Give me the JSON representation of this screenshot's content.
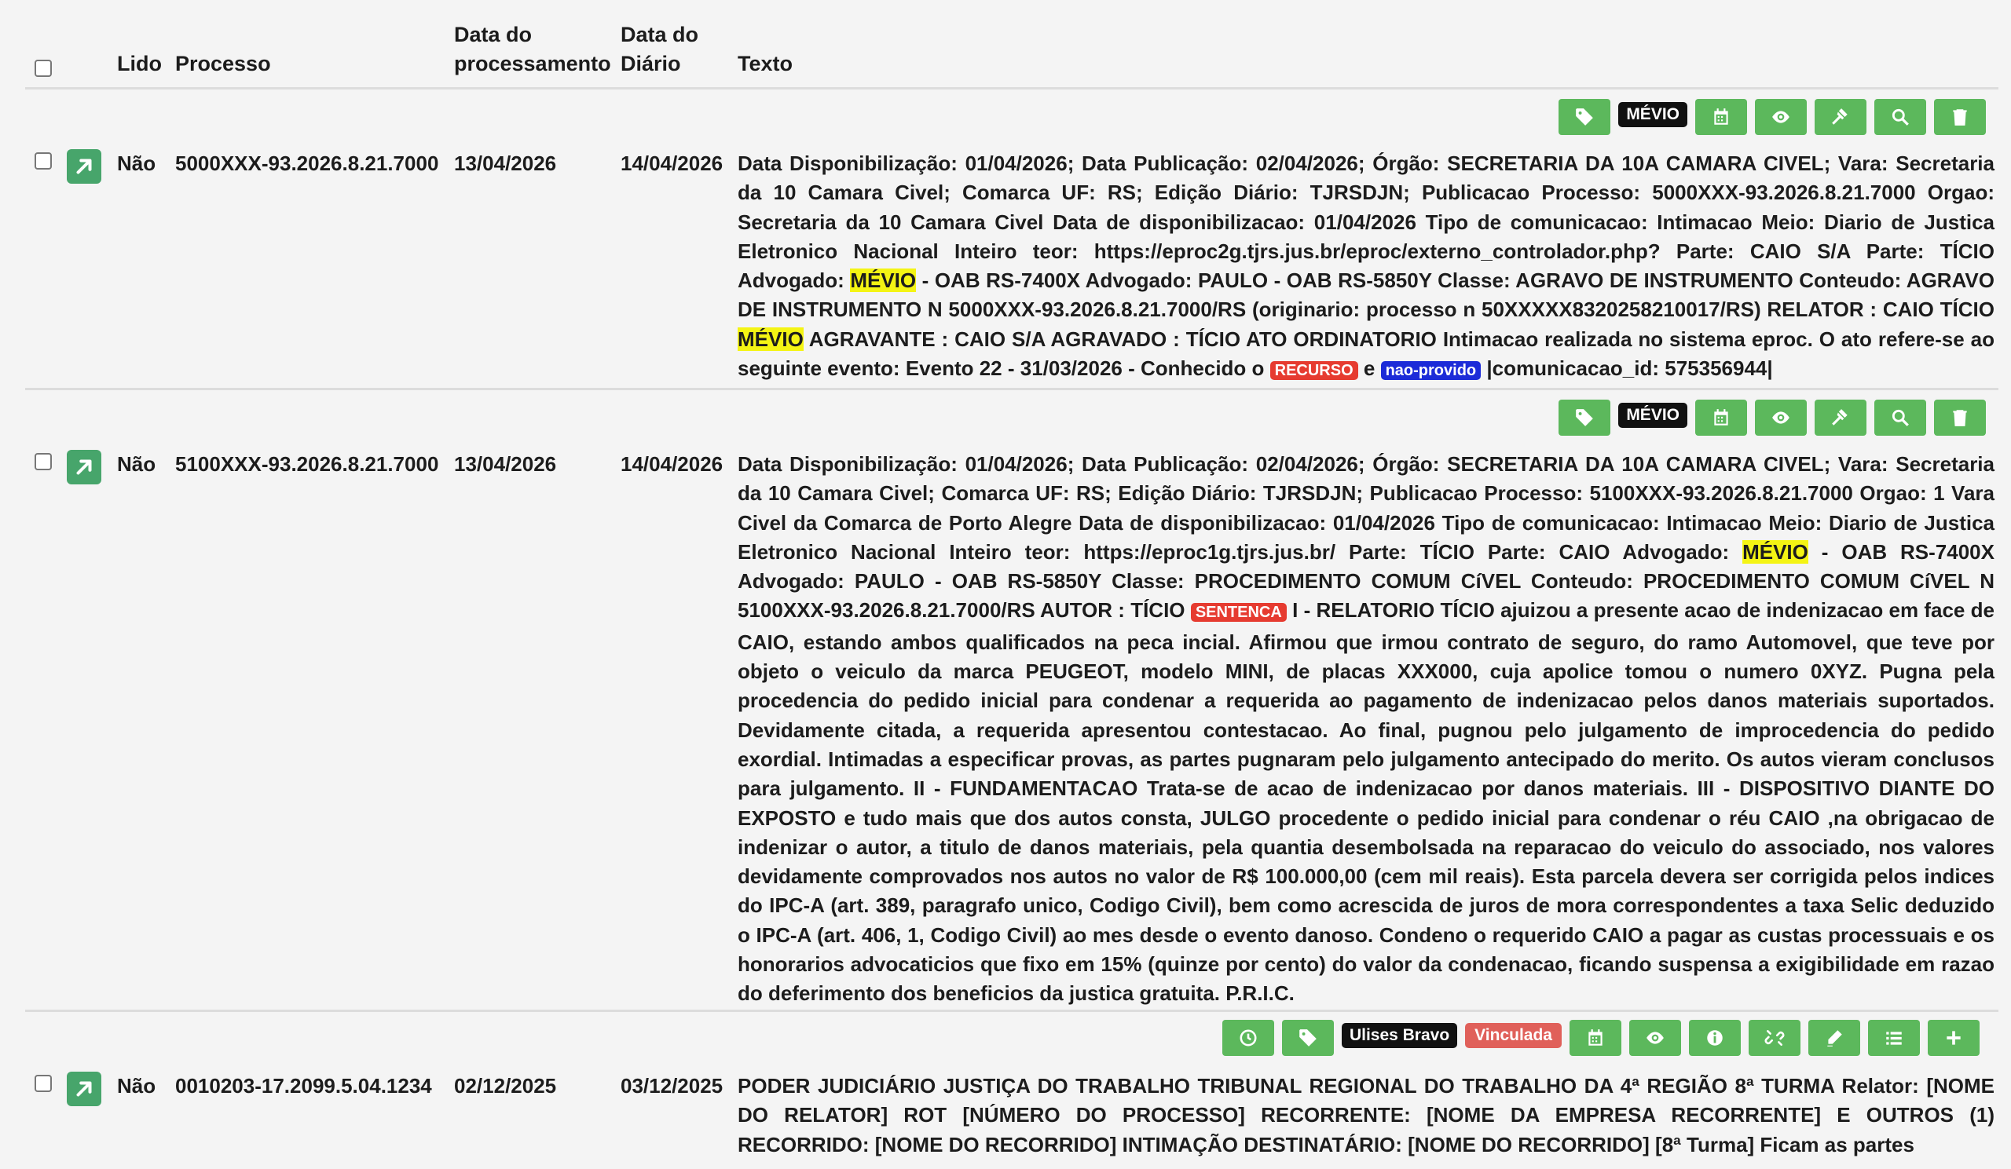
{
  "header": {
    "lido": "Lido",
    "processo": "Processo",
    "data_processamento_l1": "Data do",
    "data_processamento_l2": "processamento",
    "data_diario_l1": "Data do",
    "data_diario_l2": "Diário",
    "texto": "Texto"
  },
  "rows": [
    {
      "lido": "Não",
      "processo": "5000XXX-93.2026.8.21.7000",
      "data_processamento": "13/04/2026",
      "data_diario": "14/04/2026",
      "user_tag": "MÉVIO",
      "texto": {
        "p1": "Data Disponibilização: 01/04/2026; Data Publicação: 02/04/2026; Órgão: SECRETARIA DA 10A CAMARA CIVEL; Vara: Secretaria da 10 Camara Civel; Comarca UF: RS; Edição Diário: TJRSDJN; Publicacao Processo: 5000XXX-93.2026.8.21.7000 Orgao: Secretaria da 10 Camara Civel Data de disponibilizacao: 01/04/2026 Tipo de comunicacao: Intimacao Meio: Diario de Justica Eletronico Nacional Inteiro teor: https://eproc2g.tjrs.jus.br/eproc/externo_controlador.php? Parte: CAIO S/A Parte: TÍCIO Advogado: ",
        "hl1": "MÉVIO",
        "p2": " - OAB RS-7400X Advogado: PAULO - OAB RS-5850Y Classe: AGRAVO DE INSTRUMENTO Conteudo: AGRAVO DE INSTRUMENTO N 5000XXX-93.2026.8.21.7000/RS (originario: processo n 50XXXXX8320258210017/RS) RELATOR : CAIO TÍCIO ",
        "hl2": "MÉVIO",
        "p3": " AGRAVANTE : CAIO S/A AGRAVADO : TÍCIO ATO ORDINATORIO Intimacao realizada no sistema eproc. O ato refere-se ao seguinte evento: Evento 22 - 31/03/2026 - Conhecido o ",
        "badge1": "RECURSO",
        "p4": " e ",
        "badge2": "nao-provido",
        "p5": " |comunicacao_id: 575356944|"
      }
    },
    {
      "lido": "Não",
      "processo": "5100XXX-93.2026.8.21.7000",
      "data_processamento": "13/04/2026",
      "data_diario": "14/04/2026",
      "user_tag": "MÉVIO",
      "texto": {
        "p1": "Data Disponibilização: 01/04/2026; Data Publicação: 02/04/2026; Órgão: SECRETARIA DA 10A CAMARA CIVEL; Vara: Secretaria da 10 Camara Civel; Comarca UF: RS; Edição Diário: TJRSDJN; Publicacao Processo: 5100XXX-93.2026.8.21.7000 Orgao: 1 Vara Civel da Comarca de Porto Alegre Data de disponibilizacao: 01/04/2026 Tipo de comunicacao: Intimacao Meio: Diario de Justica Eletronico Nacional Inteiro teor: https://eproc1g.tjrs.jus.br/ Parte: TÍCIO Parte: CAIO Advogado: ",
        "hl1": "MÉVIO",
        "p2": " - OAB RS-7400X Advogado: PAULO - OAB RS-5850Y Classe: PROCEDIMENTO COMUM CíVEL Conteudo: PROCEDIMENTO COMUM CíVEL N 5100XXX-93.2026.8.21.7000/RS AUTOR : TÍCIO ",
        "badge1": "SENTENCA",
        "p3": " I - RELATORIO TÍCIO ajuizou a presente acao de indenizacao em face de CAIO, estando ambos qualificados na peca incial. Afirmou que irmou contrato de seguro, do ramo Automovel, que teve por objeto o veiculo da marca PEUGEOT, modelo MINI, de placas XXX000, cuja apolice tomou o numero 0XYZ. Pugna pela procedencia do pedido inicial para condenar a requerida ao pagamento de indenizacao pelos danos materiais suportados. Devidamente citada, a requerida apresentou contestacao. Ao final, pugnou pelo julgamento de improcedencia do pedido exordial. Intimadas a especificar provas, as partes pugnaram pelo julgamento antecipado do merito. Os autos vieram conclusos para julgamento. II - FUNDAMENTACAO Trata-se de acao de indenizacao por danos materiais. III - DISPOSITIVO DIANTE DO EXPOSTO e tudo mais que dos autos consta, JULGO procedente o pedido inicial para condenar o réu CAIO ,na obrigacao de indenizar o autor, a titulo de danos materiais, pela quantia desembolsada na reparacao do veiculo do associado, nos valores devidamente comprovados nos autos no valor de R$ 100.000,00 (cem mil reais). Esta parcela devera ser corrigida pelos indices do IPC-A (art. 389, paragrafo unico, Codigo Civil), bem como acrescida de juros de mora correspondentes a taxa Selic deduzido o IPC-A (art. 406, 1, Codigo Civil) ao mes desde o evento danoso. Condeno o requerido CAIO a pagar as custas processuais e os honorarios advocaticios que fixo em 15% (quinze por cento) do valor da condenacao, ficando suspensa a exigibilidade em razao do deferimento dos beneficios da justica gratuita. P.R.I.C."
      }
    },
    {
      "lido": "Não",
      "processo": "0010203-17.2099.5.04.1234",
      "data_processamento": "02/12/2025",
      "data_diario": "03/12/2025",
      "user_tag": "Ulises Bravo",
      "status_tag": "Vinculada",
      "texto": {
        "p1": "PODER JUDICIÁRIO JUSTIÇA DO TRABALHO TRIBUNAL REGIONAL DO TRABALHO DA 4ª REGIÃO 8ª TURMA Relator: [NOME DO RELATOR] ROT [NÚMERO DO PROCESSO] RECORRENTE: [NOME DA EMPRESA RECORRENTE] E OUTROS (1) RECORRIDO: [NOME DO RECORRIDO] INTIMAÇÃO DESTINATÁRIO: [NOME DO RECORRIDO] [8ª Turma] Ficam as partes"
      }
    }
  ],
  "colors": {
    "green": "#5cb85c",
    "arrow_green": "#47a56b",
    "highlight": "#f4f414",
    "badge_red": "#e63b30",
    "badge_blue": "#1c2bd8"
  }
}
